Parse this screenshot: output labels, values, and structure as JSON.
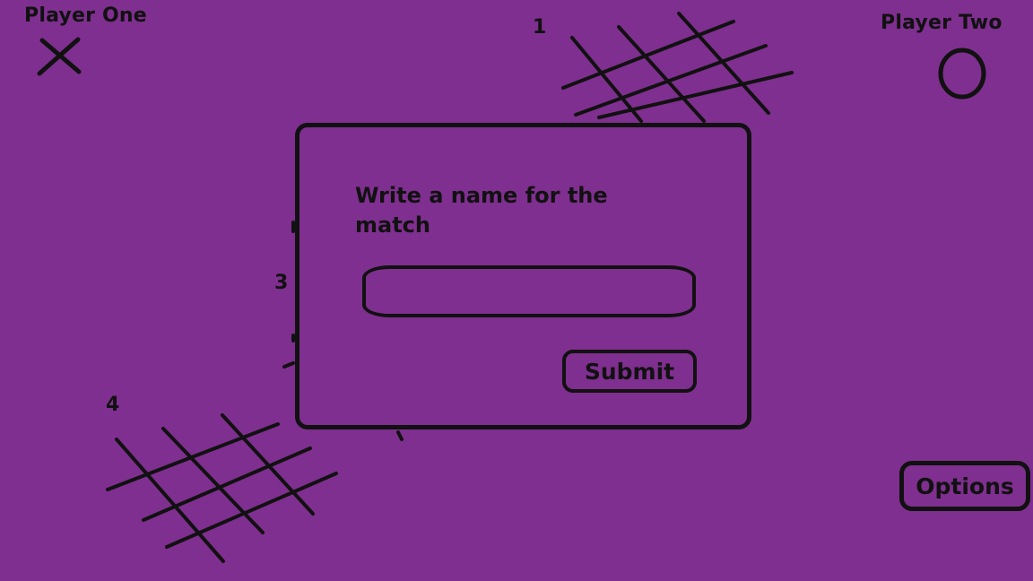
{
  "players": {
    "one": {
      "label": "Player One",
      "symbol": "x-icon"
    },
    "two": {
      "label": "Player Two",
      "symbol": "o-icon"
    }
  },
  "boards": {
    "numbers": [
      "1",
      "3",
      "4"
    ]
  },
  "dialog": {
    "title": "Write a name for the match",
    "input_value": "",
    "input_placeholder": "",
    "submit_label": "Submit"
  },
  "options": {
    "label": "Options"
  },
  "colors": {
    "background": "#7f2f8f",
    "ink": "#111111"
  }
}
